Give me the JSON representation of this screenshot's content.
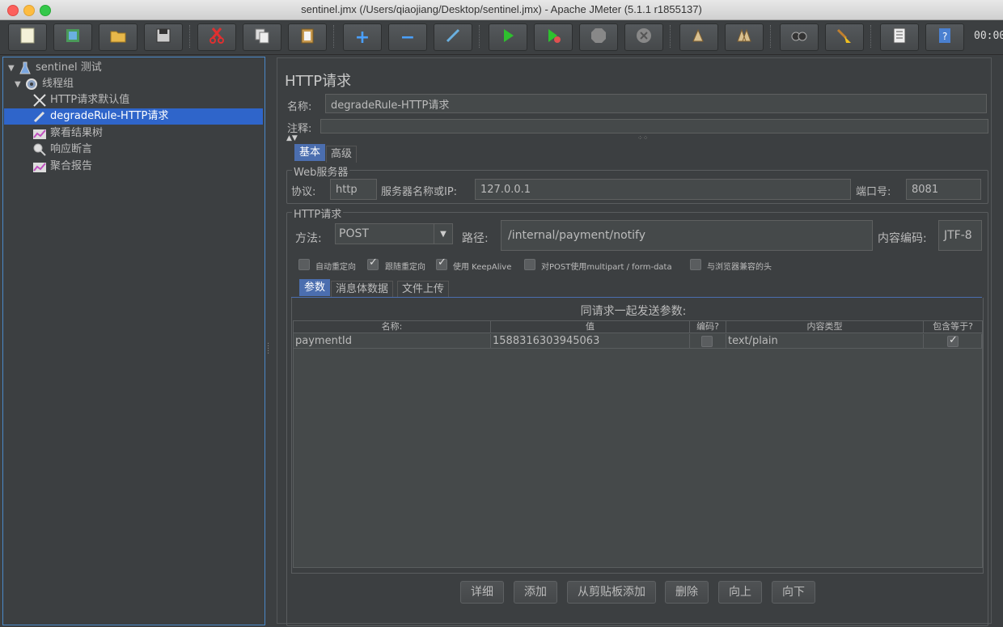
{
  "window": {
    "title": "sentinel.jmx (/Users/qiaojiang/Desktop/sentinel.jmx) - Apache JMeter (5.1.1 r1855137)"
  },
  "toolbar": {
    "timer": "00:00",
    "buttons": [
      "new-icon",
      "templates-icon",
      "open-icon",
      "save-icon",
      "cut-icon",
      "copy-icon",
      "paste-icon",
      "expand-icon",
      "collapse-icon",
      "toggle-icon",
      "start-icon",
      "start-no-pause-icon",
      "stop-icon",
      "shutdown-icon",
      "clear-icon",
      "clear-all-icon",
      "search-icon",
      "reset-search-icon",
      "function-helper-icon",
      "help-icon"
    ]
  },
  "tree": {
    "items": [
      {
        "label": "sentinel 测试",
        "icon": "test-plan-icon"
      },
      {
        "label": "线程组",
        "icon": "thread-group-icon"
      },
      {
        "label": "HTTP请求默认值",
        "icon": "config-element-icon"
      },
      {
        "label": "degradeRule-HTTP请求",
        "icon": "sampler-icon"
      },
      {
        "label": "察看结果树",
        "icon": "listener-icon"
      },
      {
        "label": "响应断言",
        "icon": "assertion-icon"
      },
      {
        "label": "聚合报告",
        "icon": "listener-icon"
      }
    ]
  },
  "panel": {
    "title": "HTTP请求",
    "name_label": "名称:",
    "name_value": "degradeRule-HTTP请求",
    "comment_label": "注释:",
    "tabs": [
      "基本",
      "高级"
    ],
    "web_server": {
      "group_title": "Web服务器",
      "protocol_label": "协议:",
      "protocol_value": "http",
      "server_label": "服务器名称或IP:",
      "server_value": "127.0.0.1",
      "port_label": "端口号:",
      "port_value": "8081"
    },
    "http_request": {
      "group_title": "HTTP请求",
      "method_label": "方法:",
      "method_value": "POST",
      "path_label": "路径:",
      "path_value": "/internal/payment/notify",
      "encoding_label": "内容编码:",
      "encoding_value": "JTF-8",
      "checkboxes": [
        {
          "label": "自动重定向",
          "checked": false
        },
        {
          "label": "跟随重定向",
          "checked": true
        },
        {
          "label": "使用 KeepAlive",
          "checked": true
        },
        {
          "label": "对POST使用multipart / form-data",
          "checked": false
        },
        {
          "label": "与浏览器兼容的头",
          "checked": false
        }
      ]
    },
    "subtabs": [
      "参数",
      "消息体数据",
      "文件上传"
    ],
    "params_title": "同请求一起发送参数:",
    "table": {
      "headers": [
        "名称:",
        "值",
        "编码?",
        "内容类型",
        "包含等于?"
      ],
      "rows": [
        {
          "name": "paymentId",
          "value": "1588316303945063",
          "encode": false,
          "content_type": "text/plain",
          "include_equals": true
        }
      ]
    },
    "buttons": [
      "详细",
      "添加",
      "从剪贴板添加",
      "删除",
      "向上",
      "向下"
    ]
  }
}
